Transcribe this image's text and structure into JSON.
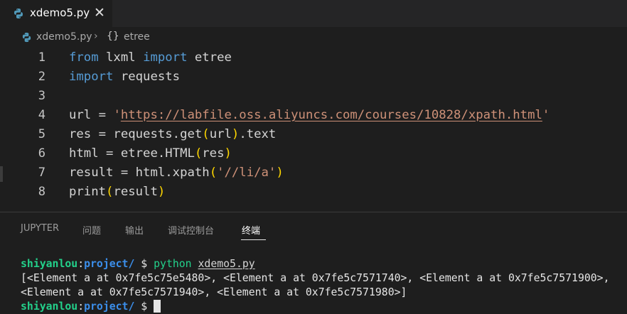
{
  "tab": {
    "filename": "xdemo5.py",
    "close_glyph": "✕"
  },
  "breadcrumb": {
    "file": "xdemo5.py",
    "separator": "›",
    "symbol_glyph": "{}",
    "symbol": "etree"
  },
  "code_lines": [
    {
      "n": "1",
      "tokens": [
        {
          "t": "from",
          "c": "kw"
        },
        {
          "t": " lxml "
        },
        {
          "t": "import",
          "c": "kw"
        },
        {
          "t": " etree"
        }
      ]
    },
    {
      "n": "2",
      "tokens": [
        {
          "t": "import",
          "c": "kw"
        },
        {
          "t": " requests"
        }
      ]
    },
    {
      "n": "3",
      "tokens": []
    },
    {
      "n": "4",
      "tokens": [
        {
          "t": "url = "
        },
        {
          "t": "'",
          "c": "str"
        },
        {
          "t": "https://labfile.oss.aliyuncs.com/courses/10828/xpath.html",
          "c": "url"
        },
        {
          "t": "'",
          "c": "str"
        }
      ]
    },
    {
      "n": "5",
      "tokens": [
        {
          "t": "res = requests.get"
        },
        {
          "t": "(",
          "c": "paren"
        },
        {
          "t": "url"
        },
        {
          "t": ")",
          "c": "paren"
        },
        {
          "t": ".text"
        }
      ]
    },
    {
      "n": "6",
      "tokens": [
        {
          "t": "html = etree.HTML"
        },
        {
          "t": "(",
          "c": "paren"
        },
        {
          "t": "res"
        },
        {
          "t": ")",
          "c": "paren"
        }
      ]
    },
    {
      "n": "7",
      "tokens": [
        {
          "t": "result = html.xpath"
        },
        {
          "t": "(",
          "c": "paren"
        },
        {
          "t": "'//li/a'",
          "c": "str"
        },
        {
          "t": ")",
          "c": "paren"
        }
      ]
    },
    {
      "n": "8",
      "tokens": [
        {
          "t": "print"
        },
        {
          "t": "(",
          "c": "paren"
        },
        {
          "t": "result"
        },
        {
          "t": ")",
          "c": "paren"
        }
      ]
    }
  ],
  "panel": {
    "tabs": [
      {
        "label": "JUPYTER"
      },
      {
        "label": "问题"
      },
      {
        "label": "输出"
      },
      {
        "label": "调试控制台"
      },
      {
        "label": "终端",
        "active": true
      }
    ]
  },
  "terminal": {
    "prompt_user": "shiyanlou",
    "prompt_colon": ":",
    "prompt_path": "project/",
    "prompt_symbol": " $ ",
    "command": "python",
    "command_arg": "xdemo5.py",
    "output_line1": "[<Element a at 0x7fe5c75e5480>, <Element a at 0x7fe5c7571740>, <Element a at 0x7fe5c7571900>,",
    "output_line2": "<Element a at 0x7fe5c7571940>, <Element a at 0x7fe5c7571980>]"
  },
  "colors": {
    "editor_bg": "#1e1e1e",
    "tabbar_bg": "#252526",
    "keyword": "#569cd6",
    "string": "#ce9178",
    "bracket": "#ffd700",
    "terminal_user": "#23d18b",
    "terminal_path": "#3b8eea"
  }
}
